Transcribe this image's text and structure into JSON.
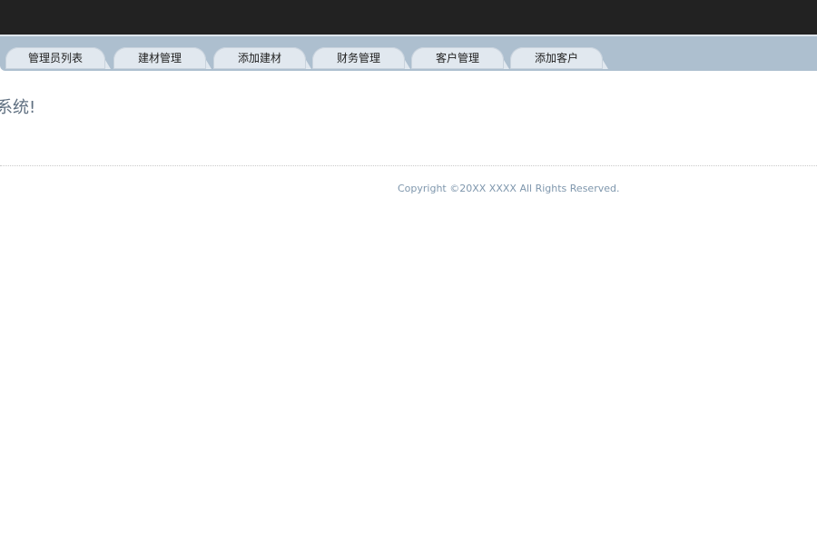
{
  "nav": {
    "tabs": [
      {
        "label": "管理员列表"
      },
      {
        "label": "建材管理"
      },
      {
        "label": "添加建材"
      },
      {
        "label": "财务管理"
      },
      {
        "label": "客户管理"
      },
      {
        "label": "添加客户"
      }
    ]
  },
  "main": {
    "welcome_text": "系统!"
  },
  "footer": {
    "copyright": "Copyright ©20XX XXXX All Rights Reserved."
  }
}
